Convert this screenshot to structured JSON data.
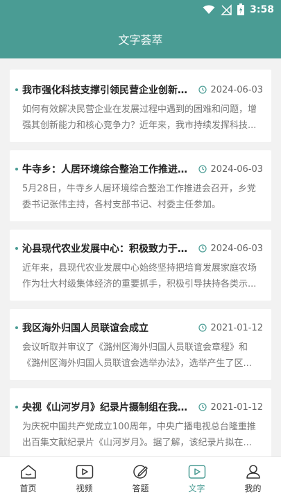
{
  "status_bar": {
    "time": "3:58"
  },
  "header": {
    "title": "文字荟萃"
  },
  "articles": [
    {
      "title": "我市强化科技支撑引领民营企业创新发...",
      "date": "2024-06-03",
      "summary": "如何有效解决民营企业在发展过程中遇到的困难和问题，增强其创新能力和核心竞争力？近年来，我市持续发挥科技..."
    },
    {
      "title": "牛寺乡：人居环境综合整治工作推进会...",
      "date": "2024-06-03",
      "summary": "5月28日，牛寺乡人居环境综合整治工作推进会召开，乡党委书记张伟主持，各村支部书记、村委主任参加。"
    },
    {
      "title": "沁县现代农业发展中心：积极致力于示...",
      "date": "2024-06-03",
      "summary": "近年来，县现代农业发展中心始终坚持把培育发展家庭农场作为壮大村级集体经济的重要抓手，积极引导扶持各类示..."
    },
    {
      "title": "我区海外归国人员联谊会成立",
      "date": "2021-01-12",
      "summary": "会议听取并审议了《潞州区海外归国人员联谊会章程》和《潞州区海外归国人员联谊会选举办法》，选举产生了区..."
    },
    {
      "title": "央视《山河岁月》纪录片摄制组在我区...",
      "date": "2021-01-12",
      "summary": "为庆祝中国共产党成立100周年，中央广播电视总台隆重推出百集文献纪录片《山河岁月》。据了解，该纪录片拟在..."
    }
  ],
  "tabs": [
    {
      "label": "首页",
      "icon": "home-icon"
    },
    {
      "label": "视频",
      "icon": "video-icon"
    },
    {
      "label": "答题",
      "icon": "edit-icon"
    },
    {
      "label": "文字",
      "icon": "text-icon",
      "active": true
    },
    {
      "label": "我的",
      "icon": "user-icon"
    }
  ],
  "colors": {
    "accent": "#4a9c94"
  }
}
